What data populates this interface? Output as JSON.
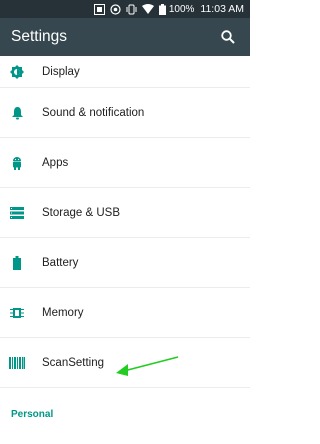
{
  "status_bar": {
    "battery_percent": "100%",
    "time": "11:03 AM",
    "icons": [
      "scanner-icon",
      "sync-icon",
      "vibrate-icon",
      "wifi-icon",
      "battery-icon"
    ]
  },
  "toolbar": {
    "title": "Settings",
    "search_icon": "search-icon"
  },
  "items": [
    {
      "label": "Display",
      "icon": "brightness-icon"
    },
    {
      "label": "Sound & notification",
      "icon": "bell-icon"
    },
    {
      "label": "Apps",
      "icon": "android-icon"
    },
    {
      "label": "Storage & USB",
      "icon": "storage-icon"
    },
    {
      "label": "Battery",
      "icon": "battery-icon"
    },
    {
      "label": "Memory",
      "icon": "memory-icon"
    },
    {
      "label": "ScanSetting",
      "icon": "barcode-icon"
    }
  ],
  "sections": {
    "personal": "Personal"
  },
  "colors": {
    "status_bar": "#263238",
    "toolbar": "#37474f",
    "icon": "#009688",
    "section_header": "#009688",
    "annotation_arrow": "#22cc22"
  }
}
